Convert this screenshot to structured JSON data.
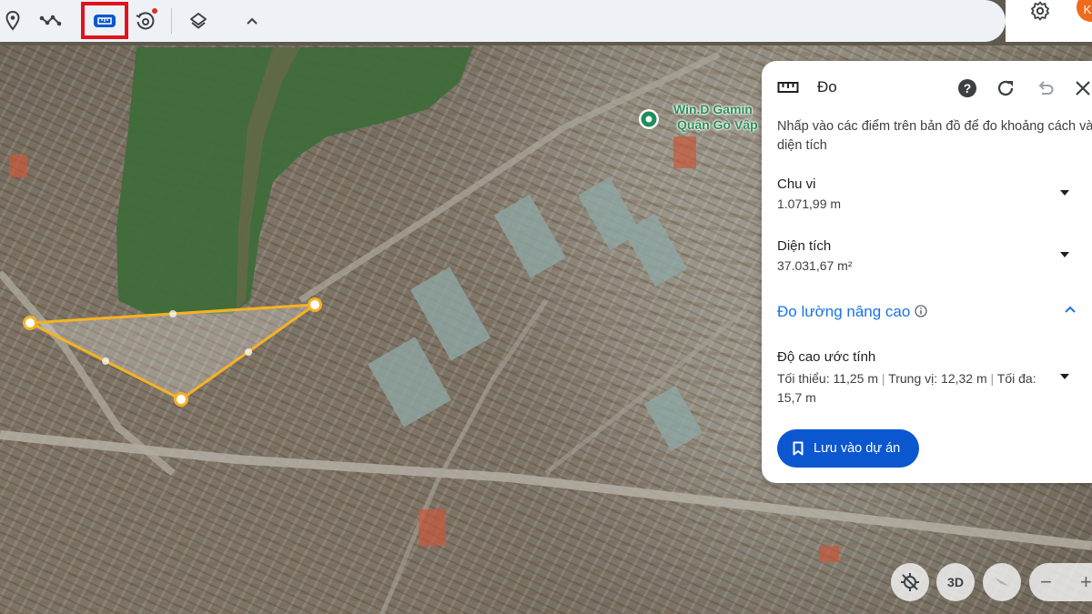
{
  "toolbar": {
    "tools": [
      {
        "name": "pin-icon"
      },
      {
        "name": "path-icon"
      },
      {
        "name": "ruler-icon",
        "active": true
      },
      {
        "name": "history-icon",
        "notification": true
      },
      {
        "name": "layers-icon"
      },
      {
        "name": "chevron-up-icon"
      }
    ]
  },
  "account": {
    "avatar_initial": "K"
  },
  "map": {
    "place_label_line1": "Win.D Gamin",
    "place_label_line2": "Quận Gò Vấp",
    "measure_color": "#f5b223"
  },
  "panel": {
    "title": "Đo",
    "description": "Nhấp vào các điểm trên bản đồ để đo khoảng cách và diện tích",
    "perimeter_label": "Chu vi",
    "perimeter_value": "1.071,99 m",
    "area_label": "Diện tích",
    "area_value": "37.031,67 m²",
    "advanced_label": "Đo lường nâng cao",
    "elevation_label": "Độ cao ước tính",
    "elevation_min": "Tối thiểu: 11,25 m",
    "elevation_median": "Trung vị: 12,32 m",
    "elevation_max": "Tối đa: 15,7 m",
    "save_label": "Lưu vào dự án",
    "accent_color": "#0b57d0"
  },
  "controls": {
    "view_3d_label": "3D",
    "zoom_out_label": "−",
    "zoom_in_label": "+"
  }
}
